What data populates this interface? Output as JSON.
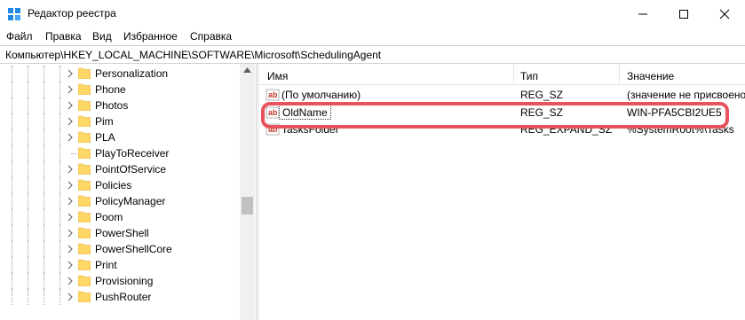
{
  "window": {
    "title": "Редактор реестра"
  },
  "menu": [
    "Файл",
    "Правка",
    "Вид",
    "Избранное",
    "Справка"
  ],
  "address": "Компьютер\\HKEY_LOCAL_MACHINE\\SOFTWARE\\Microsoft\\SchedulingAgent",
  "tree": {
    "items": [
      {
        "label": "Personalization",
        "expandable": true
      },
      {
        "label": "Phone",
        "expandable": true
      },
      {
        "label": "Photos",
        "expandable": true
      },
      {
        "label": "Pim",
        "expandable": true
      },
      {
        "label": "PLA",
        "expandable": true
      },
      {
        "label": "PlayToReceiver",
        "expandable": false
      },
      {
        "label": "PointOfService",
        "expandable": true
      },
      {
        "label": "Policies",
        "expandable": true
      },
      {
        "label": "PolicyManager",
        "expandable": true
      },
      {
        "label": "Poom",
        "expandable": true
      },
      {
        "label": "PowerShell",
        "expandable": true
      },
      {
        "label": "PowerShellCore",
        "expandable": true
      },
      {
        "label": "Print",
        "expandable": true
      },
      {
        "label": "Provisioning",
        "expandable": true
      },
      {
        "label": "PushRouter",
        "expandable": true
      }
    ]
  },
  "list": {
    "columns": {
      "name": "Имя",
      "type": "Тип",
      "data": "Значение"
    },
    "rows": [
      {
        "name": "(По умолчанию)",
        "type": "REG_SZ",
        "data": "(значение не присвоено)",
        "icon": "ab-string-icon"
      },
      {
        "name": "OldName",
        "type": "REG_SZ",
        "data": "WIN-PFA5CBI2UE5",
        "icon": "ab-string-icon"
      },
      {
        "name": "TasksFolder",
        "type": "REG_EXPAND_SZ",
        "data": "%SystemRoot%\\Tasks",
        "icon": "ab-string-icon"
      }
    ]
  },
  "colors": {
    "highlight": "#e8525d",
    "folder": "#ffd766",
    "icon_red": "#c0392b"
  }
}
